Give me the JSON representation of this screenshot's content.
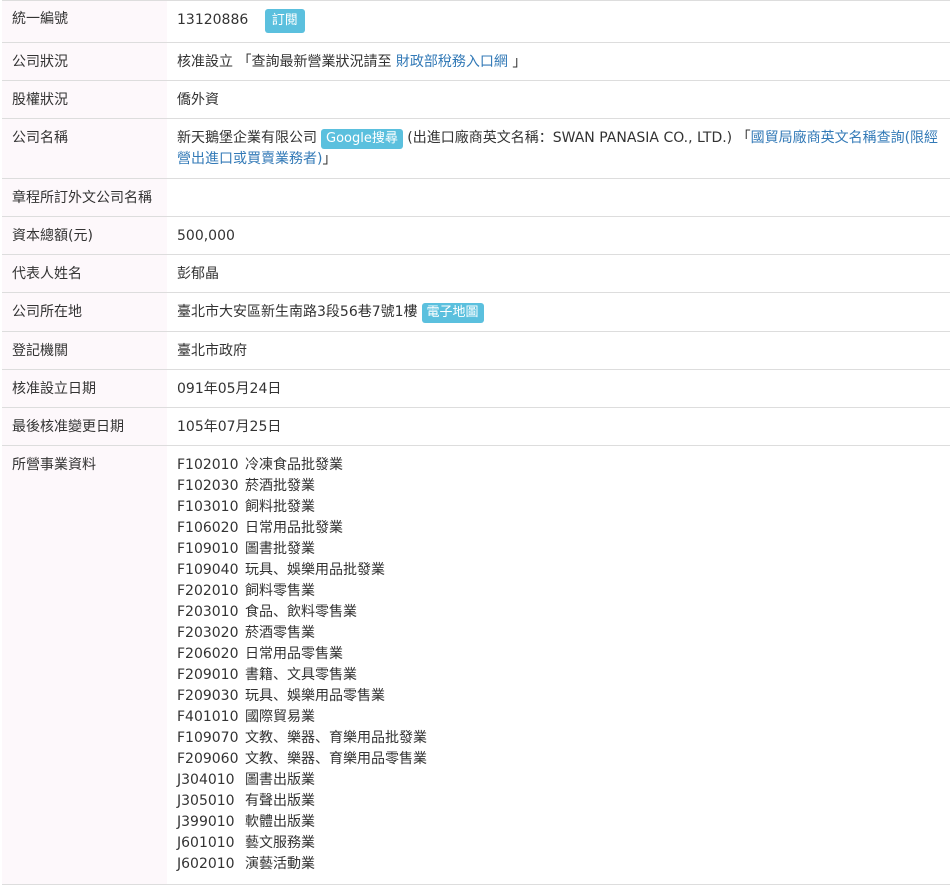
{
  "rows": {
    "ban": {
      "label": "統一編號",
      "value": "13120886",
      "subscribe": "訂閱"
    },
    "status": {
      "label": "公司狀況",
      "value": "核准設立",
      "query_open": "「查詢最新營業狀況請至",
      "query_link": "財政部稅務入口網",
      "query_close": "」"
    },
    "equity": {
      "label": "股權狀況",
      "value": "僑外資"
    },
    "name": {
      "label": "公司名稱",
      "value": "新天鵝堡企業有限公司",
      "google": "Google搜尋",
      "english": "(出進口廠商英文名稱：SWAN PANASIA CO., LTD.)",
      "trade_open": "「",
      "trade_link": "國貿局廠商英文名稱查詢(限經營出進口或買賣業務者)",
      "trade_close": "」"
    },
    "foreign_name": {
      "label": "章程所訂外文公司名稱",
      "value": ""
    },
    "capital": {
      "label": "資本總額(元)",
      "value": "500,000"
    },
    "representative": {
      "label": "代表人姓名",
      "value": "彭郁晶"
    },
    "address": {
      "label": "公司所在地",
      "value": "臺北市大安區新生南路3段56巷7號1樓",
      "map": "電子地圖"
    },
    "authority": {
      "label": "登記機關",
      "value": "臺北市政府"
    },
    "established": {
      "label": "核准設立日期",
      "value": "091年05月24日"
    },
    "last_changed": {
      "label": "最後核准變更日期",
      "value": "105年07月25日"
    },
    "business": {
      "label": "所營事業資料",
      "items": [
        {
          "code": "F102010",
          "name": "冷凍食品批發業"
        },
        {
          "code": "F102030",
          "name": "菸酒批發業"
        },
        {
          "code": "F103010",
          "name": "飼料批發業"
        },
        {
          "code": "F106020",
          "name": "日常用品批發業"
        },
        {
          "code": "F109010",
          "name": "圖書批發業"
        },
        {
          "code": "F109040",
          "name": "玩具、娛樂用品批發業"
        },
        {
          "code": "F202010",
          "name": "飼料零售業"
        },
        {
          "code": "F203010",
          "name": "食品、飲料零售業"
        },
        {
          "code": "F203020",
          "name": "菸酒零售業"
        },
        {
          "code": "F206020",
          "name": "日常用品零售業"
        },
        {
          "code": "F209010",
          "name": "書籍、文具零售業"
        },
        {
          "code": "F209030",
          "name": "玩具、娛樂用品零售業"
        },
        {
          "code": "F401010",
          "name": "國際貿易業"
        },
        {
          "code": "F109070",
          "name": "文教、樂器、育樂用品批發業"
        },
        {
          "code": "F209060",
          "name": "文教、樂器、育樂用品零售業"
        },
        {
          "code": "J304010",
          "name": "圖書出版業"
        },
        {
          "code": "J305010",
          "name": "有聲出版業"
        },
        {
          "code": "J399010",
          "name": "軟體出版業"
        },
        {
          "code": "J601010",
          "name": "藝文服務業"
        },
        {
          "code": "J602010",
          "name": "演藝活動業"
        }
      ]
    }
  }
}
